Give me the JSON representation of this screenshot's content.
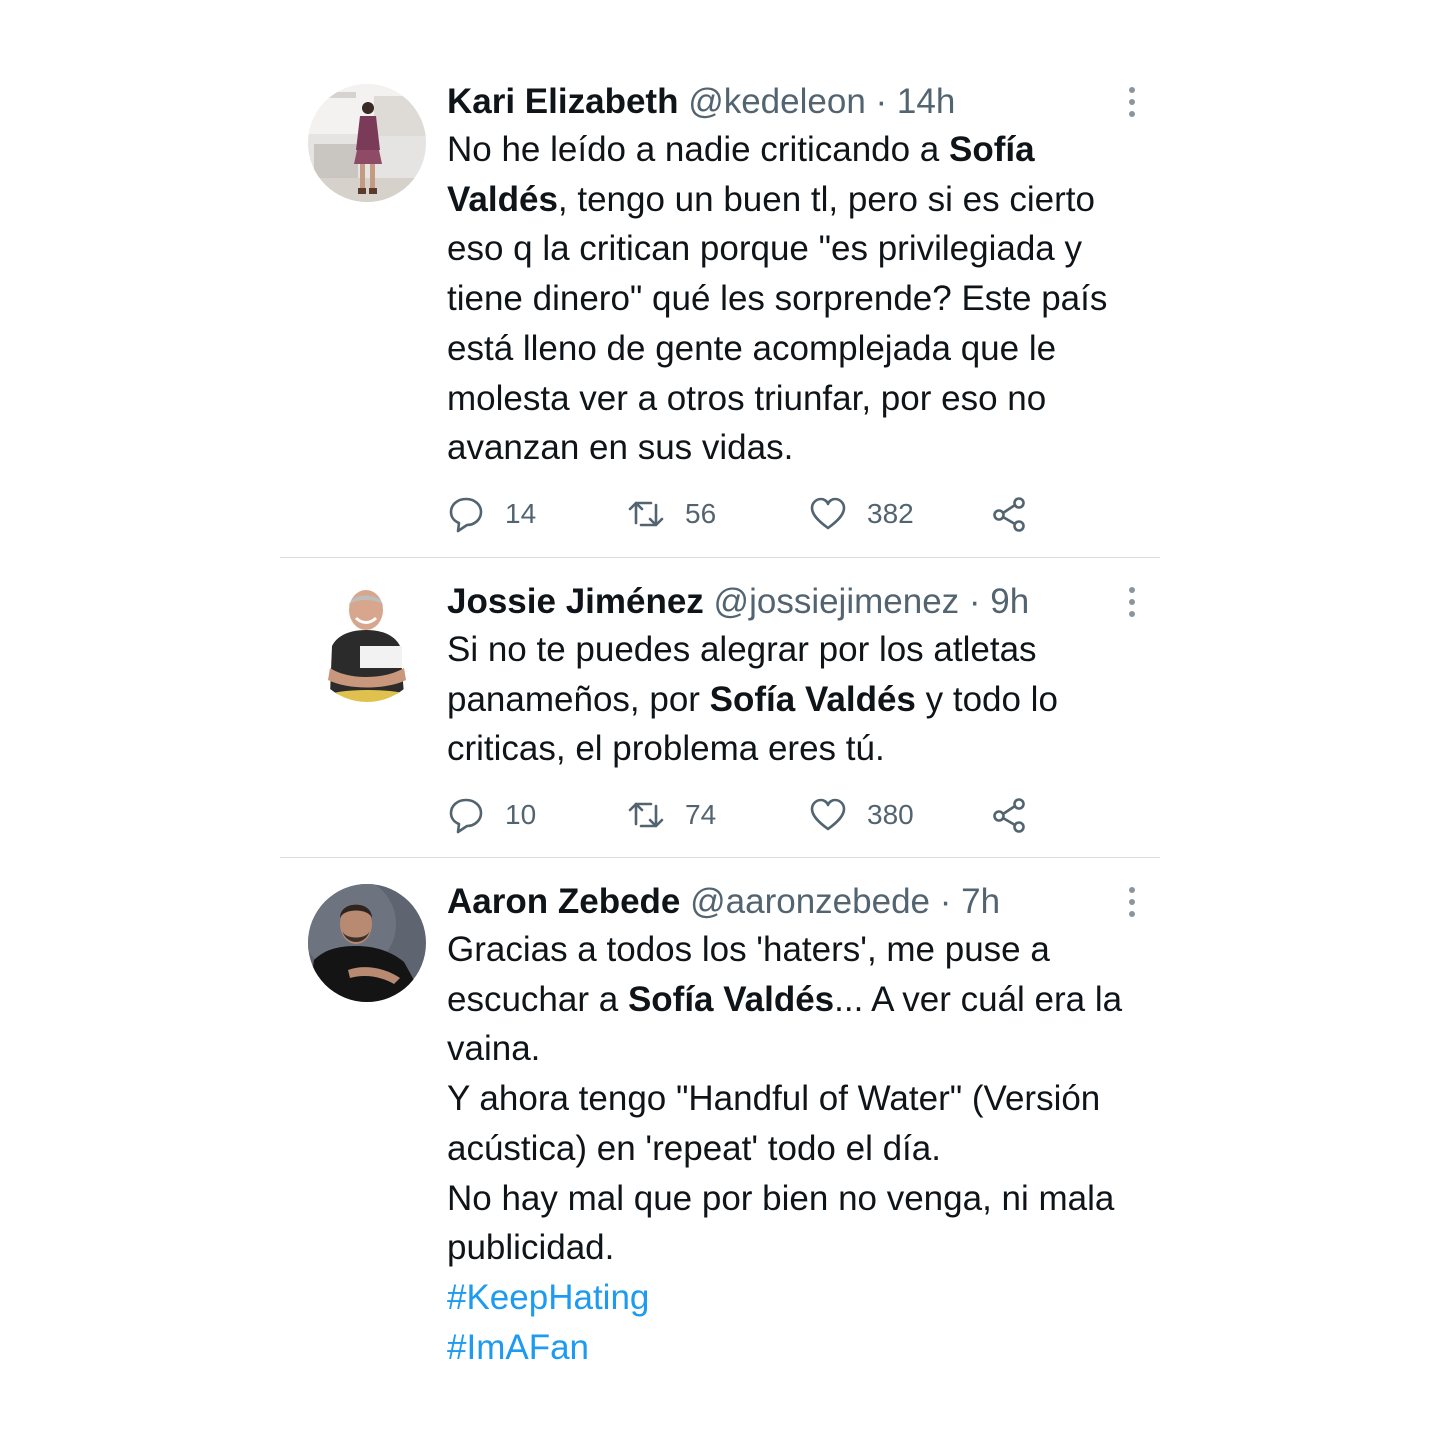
{
  "colors": {
    "text": "#0f1419",
    "muted": "#536471",
    "link": "#1d9bf0",
    "divider": "#d9dde1"
  },
  "tweets": [
    {
      "name": "Kari Elizabeth",
      "handle": "@kedeleon",
      "separator": "·",
      "time": "14h",
      "body": {
        "pre": "No he leído a nadie criticando a ",
        "bold": "Sofía Valdés",
        "post": ", tengo un buen tl, pero si es cierto eso q la critican porque \"es privilegiada y tiene dinero\" qué les sorprende? Este país está lleno de gente acomplejada que le molesta ver a otros triunfar, por eso no avanzan en sus vidas."
      },
      "replies": "14",
      "retweets": "56",
      "likes": "382"
    },
    {
      "name": "Jossie Jiménez",
      "handle": "@jossiejimenez",
      "separator": "·",
      "time": "9h",
      "body": {
        "pre": "Si no te puedes alegrar por los atletas panameños, por ",
        "bold": "Sofía Valdés",
        "post": " y todo lo criticas, el problema eres tú."
      },
      "replies": "10",
      "retweets": "74",
      "likes": "380"
    },
    {
      "name": "Aaron Zebede",
      "handle": "@aaronzebede",
      "separator": "·",
      "time": "7h",
      "body": {
        "pre": "Gracias a todos los 'haters', me puse a escuchar a ",
        "bold": "Sofía Valdés",
        "post": "... A ver cuál era la vaina.",
        "line2": "Y ahora tengo \"Handful of Water\" (Versión acústica) en 'repeat' todo el día.",
        "line3": "No hay mal que por bien no venga, ni mala publicidad."
      },
      "hashtags": [
        "#KeepHating",
        "#ImAFan"
      ]
    }
  ],
  "icons": {
    "reply": "speech-bubble-icon",
    "retweet": "retweet-icon",
    "like": "heart-icon",
    "share": "share-icon",
    "more": "vertical-dots-icon"
  }
}
